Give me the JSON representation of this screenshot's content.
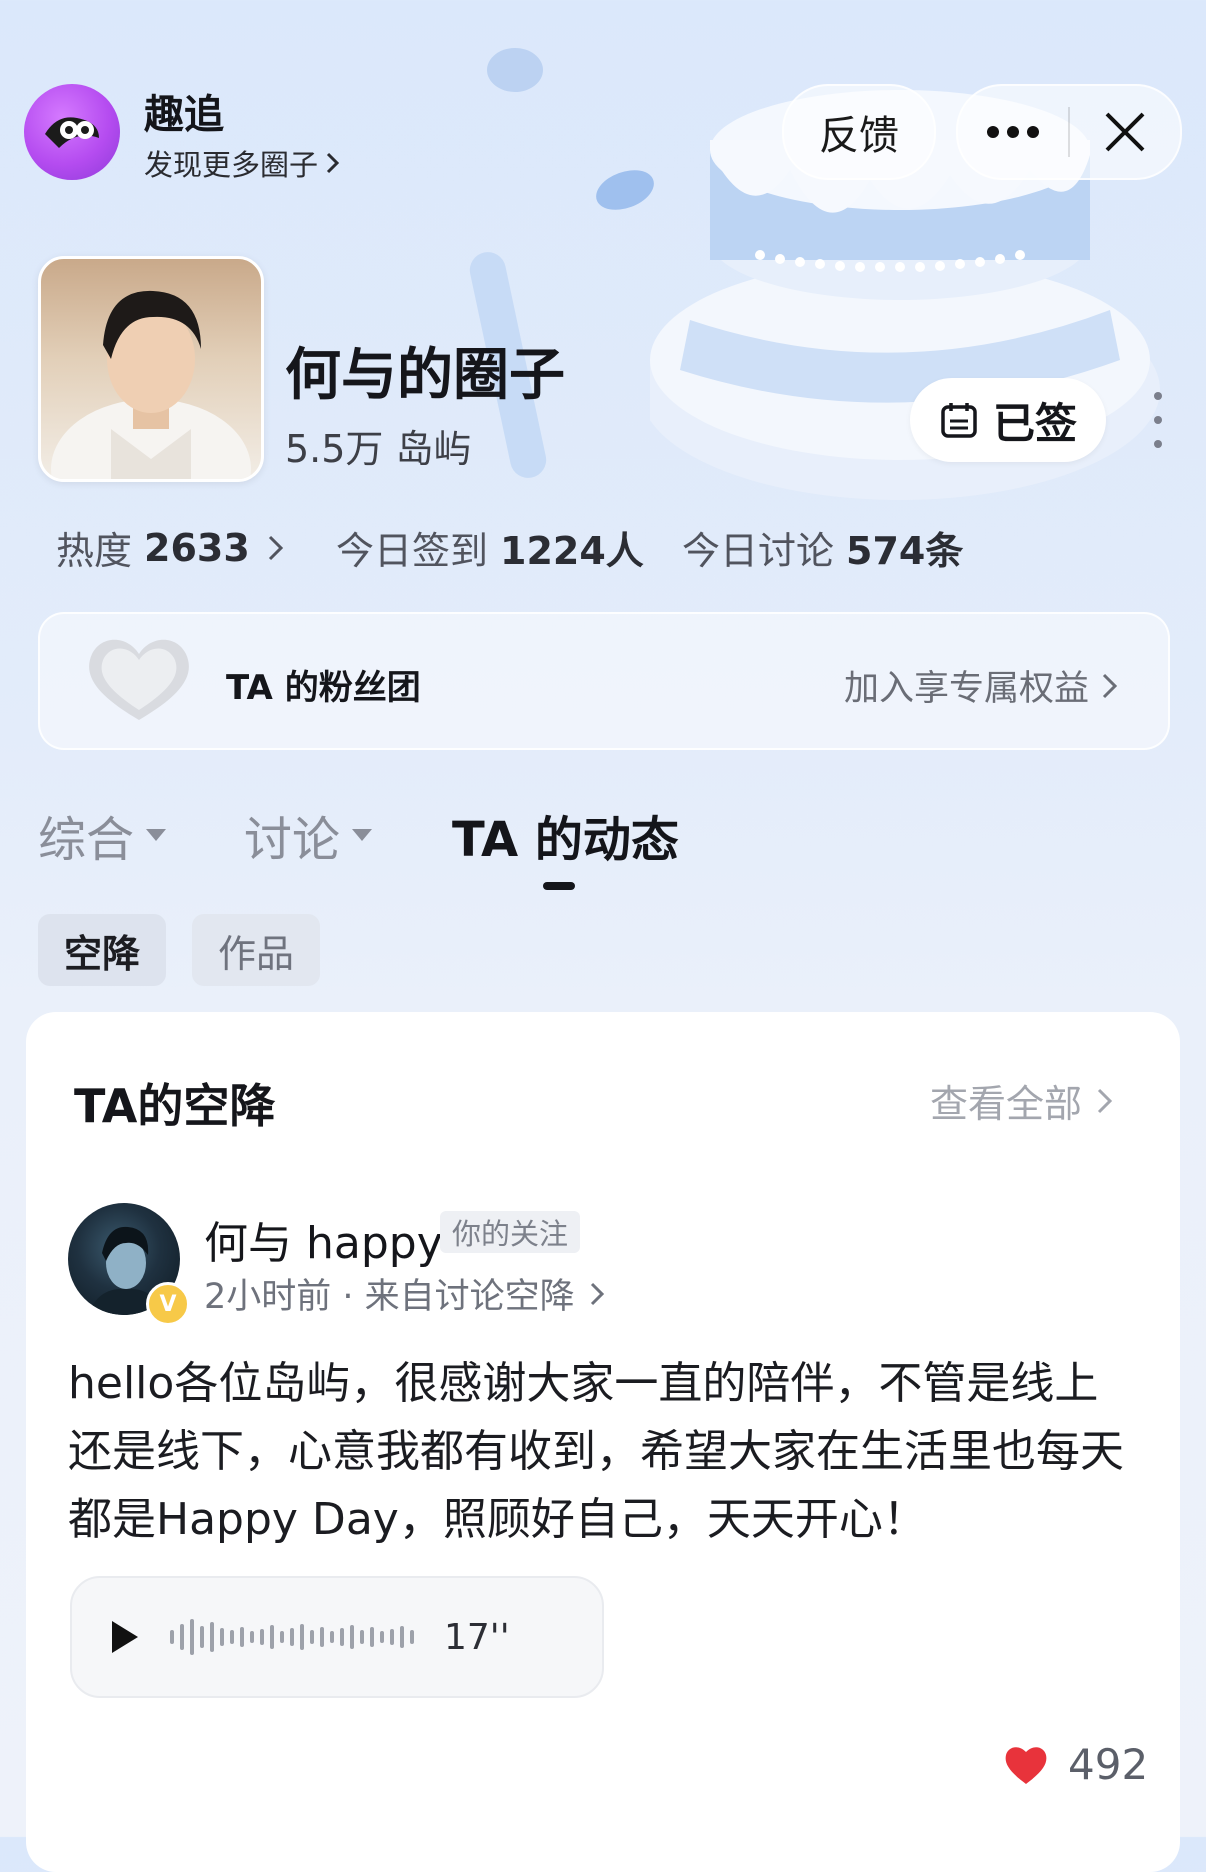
{
  "header": {
    "app_name": "趣追",
    "discover_label": "发现更多圈子",
    "feedback_label": "反馈"
  },
  "circle": {
    "title": "何与的圈子",
    "members": "5.5万 岛屿",
    "signed_label": "已签"
  },
  "stats": {
    "heat_label": "热度",
    "heat_value": "2633",
    "checkin_label": "今日签到",
    "checkin_value": "1224人",
    "discuss_label": "今日讨论",
    "discuss_value": "574条"
  },
  "fan_club": {
    "title": "TA 的粉丝团",
    "join_label": "加入享专属权益"
  },
  "tabs": [
    {
      "label": "综合"
    },
    {
      "label": "讨论"
    },
    {
      "label": "TA 的动态"
    }
  ],
  "chips": [
    {
      "label": "空降"
    },
    {
      "label": "作品"
    }
  ],
  "section": {
    "title": "TA的空降",
    "view_all": "查看全部"
  },
  "post": {
    "author": "何与 happy",
    "follow_tag": "你的关注",
    "meta": "2小时前 · 来自讨论空降",
    "text": "hello各位岛屿，很感谢大家一直的陪伴，不管是线上还是线下，心意我都有收到，希望大家在生活里也每天都是Happy Day，照顾好自己，天天开心！",
    "voice_duration": "17''",
    "likes": "492"
  },
  "colors": {
    "accent_like": "#e8333b",
    "badge_gold": "#f7c948",
    "logo_purple": "#b54cf0"
  }
}
